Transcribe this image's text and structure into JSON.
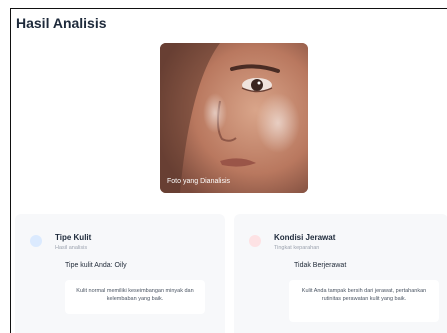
{
  "page": {
    "title": "Hasil Analisis"
  },
  "photo": {
    "caption": "Foto yang Dianalisis"
  },
  "cards": [
    {
      "title": "Tipe Kulit",
      "subtitle": "Hasil analisis",
      "value": "Tipe kulit Anda: Oily",
      "description": "Kulit normal memiliki keseimbangan minyak dan kelembaban yang baik.",
      "dot_color": "#dbeafe"
    },
    {
      "title": "Kondisi Jerawat",
      "subtitle": "Tingkat keparahan",
      "value": "Tidak Berjerawat",
      "description": "Kulit Anda tampak bersih dari jerawat, pertahankan rutinitas perawatan kulit yang baik.",
      "dot_color": "#fde2e4"
    }
  ]
}
